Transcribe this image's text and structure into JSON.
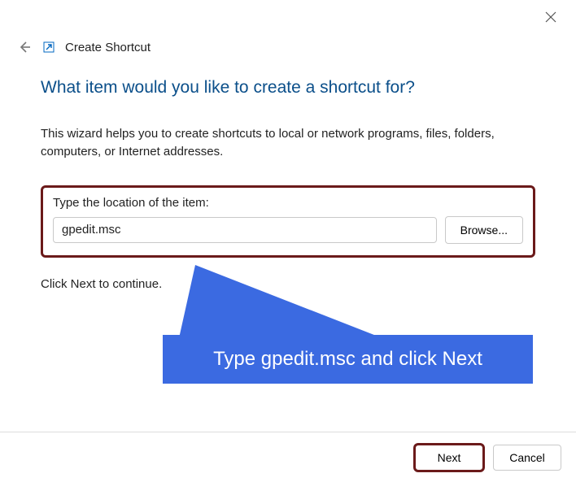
{
  "header": {
    "title": "Create Shortcut"
  },
  "heading": "What item would you like to create a shortcut for?",
  "description": "This wizard helps you to create shortcuts to local or network programs, files, folders, computers, or Internet addresses.",
  "field": {
    "label": "Type the location of the item:",
    "value": "gpedit.msc",
    "browse_label": "Browse..."
  },
  "continue_text": "Click Next to continue.",
  "callout_text": "Type gpedit.msc and click Next",
  "footer": {
    "next_label": "Next",
    "cancel_label": "Cancel"
  }
}
